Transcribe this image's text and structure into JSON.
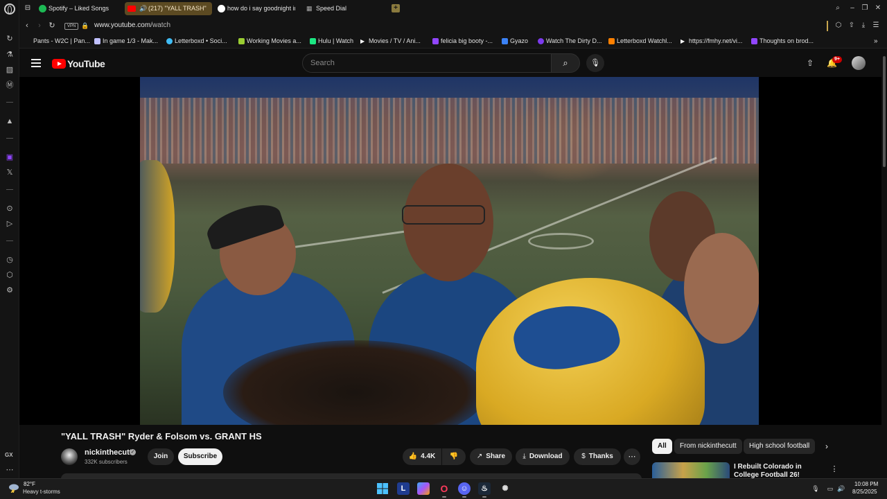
{
  "browser": {
    "tabs": [
      {
        "label": "Spotify – Liked Songs",
        "icon": "spotify-icon",
        "color": "#1db954"
      },
      {
        "label": "(217) \"YALL TRASH\"",
        "icon": "youtube-icon",
        "color": "#ff0000",
        "active": true
      },
      {
        "label": "how do i say goodnight in",
        "icon": "google-icon",
        "color": "#ffffff"
      },
      {
        "label": "Speed Dial",
        "icon": "speed-dial-icon",
        "color": "#888888"
      }
    ],
    "vpn_label": "VPN",
    "url_host": "www.youtube.com",
    "url_path": "/watch",
    "bookmarks": [
      {
        "label": "Pants - W2C | Pan...",
        "color": "#666666"
      },
      {
        "label": "In game 1/3 - Mak...",
        "color": "#c0c0ff"
      },
      {
        "label": "Letterboxd • Soci...",
        "color": "#40bcf4"
      },
      {
        "label": "Working Movies a...",
        "color": "#9acd32"
      },
      {
        "label": "Hulu | Watch",
        "color": "#1ce783"
      },
      {
        "label": "Movies / TV / Ani...",
        "color": "#ffffff"
      },
      {
        "label": "felicia big booty -...",
        "color": "#9146ff"
      },
      {
        "label": "Gyazo",
        "color": "#3b82f6"
      },
      {
        "label": "Watch The Dirty D...",
        "color": "#7c3aed"
      },
      {
        "label": "Letterboxd Watchl...",
        "color": "#ff8000"
      },
      {
        "label": "https://fmhy.net/vi...",
        "color": "#ffffff"
      },
      {
        "label": "Thoughts on brod...",
        "color": "#9146ff"
      }
    ],
    "sidebar_gx": "GX"
  },
  "youtube": {
    "logo_text": "YouTube",
    "search_placeholder": "Search",
    "notification_badge": "9+",
    "video": {
      "title": "\"YALL TRASH\" Ryder & Folsom vs. GRANT HS",
      "channel": "nickinthecutt",
      "subscribers": "332K subscribers",
      "join_label": "Join",
      "subscribe_label": "Subscribe",
      "likes": "4.4K",
      "share_label": "Share",
      "download_label": "Download",
      "thanks_label": "Thanks"
    },
    "chips": [
      "All",
      "From nickinthecutt",
      "High school football"
    ],
    "recommendation": {
      "title": "I Rebuilt Colorado in College Football 26!"
    }
  },
  "taskbar": {
    "weather_temp": "82°F",
    "weather_desc": "Heavy t-storms",
    "time": "10:08 PM",
    "date": "8/25/2025"
  },
  "colors": {
    "accent": "#ff0000",
    "opera_tab": "#5c4a22"
  }
}
